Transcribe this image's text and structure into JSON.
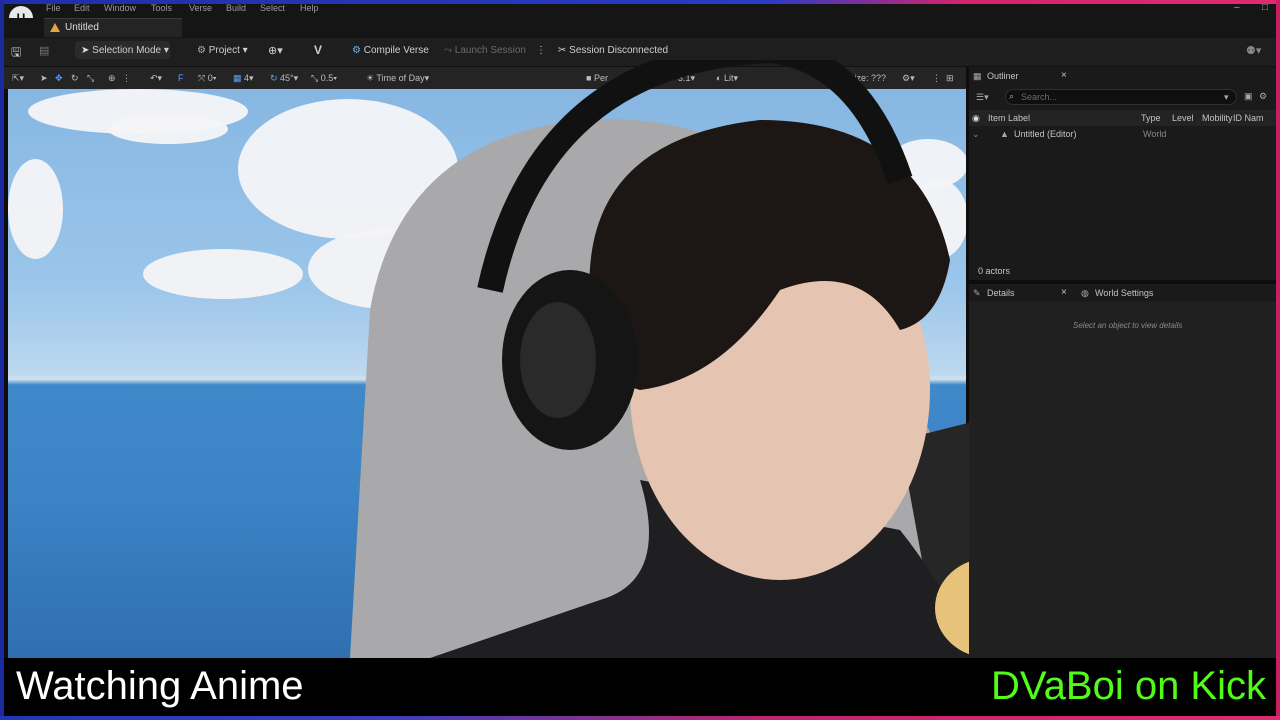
{
  "menu": [
    "File",
    "Edit",
    "Window",
    "Tools",
    "Verse",
    "Build",
    "Select",
    "Help"
  ],
  "document_tab": "Untitled",
  "toolbar": {
    "mode": "Selection Mode",
    "project": "Project",
    "compile": "Compile Verse",
    "launch": "Launch Session",
    "session": "Session Disconnected"
  },
  "viewport_toolbar": {
    "snap_count": "0",
    "grid": "4",
    "rotation": "45°",
    "scale": "0.5",
    "time_of_day": "Time of Day",
    "perspective": "Per",
    "speed": "3.1",
    "lit": "Lit",
    "project_size": "Project Size: ???"
  },
  "outliner": {
    "title": "Outliner",
    "search_placeholder": "Search...",
    "columns": [
      "Item Label",
      "Type",
      "Level",
      "Mobility",
      "ID Nam"
    ],
    "rows": [
      {
        "label": "Untitled (Editor)",
        "type": "World"
      }
    ],
    "actor_count": "0 actors"
  },
  "details": {
    "tab_details": "Details",
    "tab_world": "World Settings",
    "empty_message": "Select an object to view details"
  },
  "overlay": {
    "left_text": "Watching Anime",
    "right_text": "DVaBoi on Kick",
    "left_color": "#ffffff",
    "right_color": "#53fc18"
  }
}
